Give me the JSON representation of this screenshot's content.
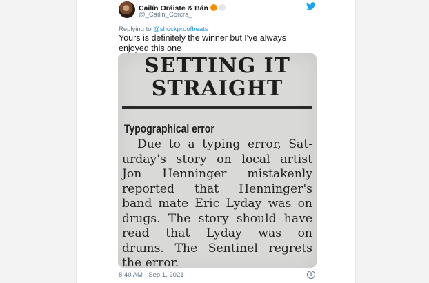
{
  "author": {
    "display_name": "Cailín Oráiste & Bán",
    "handle": "@_Cailin_Corcra_"
  },
  "reply": {
    "prefix": "Replying to ",
    "mention": "@shockproofbeats"
  },
  "tweet": {
    "text": "Yours is definitely the winner but I've always enjoyed this one",
    "timestamp": "8:40 AM · Sep 1, 2021"
  },
  "clipping": {
    "headline_line1": "SETTING IT",
    "headline_line2": "STRAIGHT",
    "subheading": "Typographical error",
    "body_lines": [
      "Due to a typing error, Sat-",
      "urday's story on local artist",
      "Jon Henninger mistakenly",
      "reported that Henninger's",
      "band mate Eric Lyday was on",
      "drugs. The story should have",
      "read that Lyday was on",
      "drums. The Sentinel regrets",
      "the error."
    ]
  },
  "icons": {
    "brand": "twitter-bird-icon",
    "info": "info-icon",
    "heart": "orange-heart-icon",
    "circle": "white-circle-icon"
  },
  "colors": {
    "link": "#1b95e0",
    "twitter_blue": "#1da1f2",
    "heart": "#f4900c"
  }
}
